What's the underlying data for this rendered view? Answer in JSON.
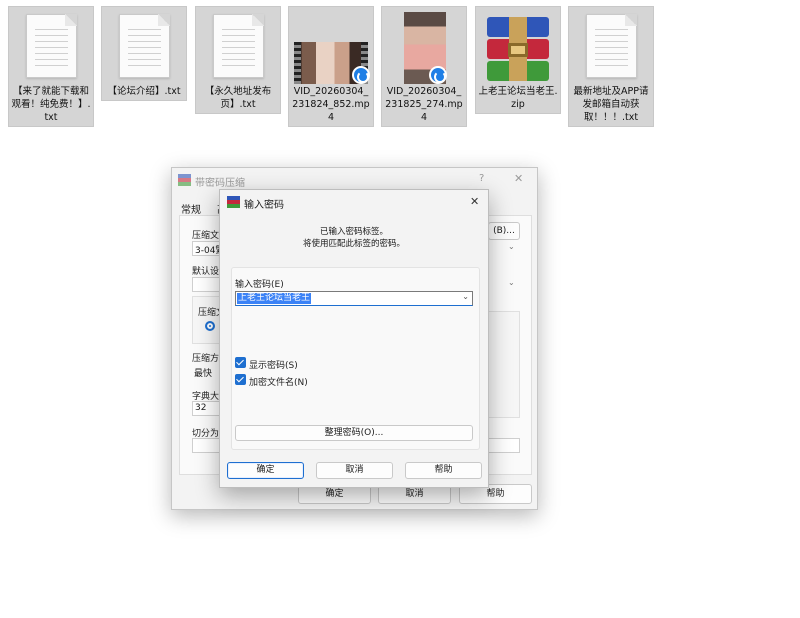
{
  "files": [
    {
      "name": "【来了就能下载和观看！纯免费！】.txt",
      "icon": "text-file-icon"
    },
    {
      "name": "【论坛介绍】.txt",
      "icon": "text-file-icon"
    },
    {
      "name": "【永久地址发布页】.txt",
      "icon": "text-file-icon"
    },
    {
      "name": "VID_20260304_231824_852.mp4",
      "icon": "video-file-icon"
    },
    {
      "name": "VID_20260304_231825_274.mp4",
      "icon": "video-file-icon"
    },
    {
      "name": "上老王论坛当老王.zip",
      "icon": "winrar-archive-icon"
    },
    {
      "name": "最新地址及APP请发邮箱自动获取！！！.txt",
      "icon": "text-file-icon"
    }
  ],
  "outer_dialog": {
    "title": "带密码压缩",
    "help": "?",
    "close": "✕",
    "tabs": [
      "常规",
      "高"
    ],
    "archive_label": "压缩文",
    "archive_value": "3-04繁",
    "browse_label": "(B)...",
    "default_label": "默认设",
    "format_label": "压缩文",
    "method_label": "压缩方",
    "method_value": "最快",
    "dict_label": "字典大",
    "dict_value": "32",
    "split_label": "切分为",
    "ok": "确定",
    "cancel": "取消",
    "help_btn": "帮助"
  },
  "inner_dialog": {
    "title": "输入密码",
    "close": "✕",
    "info_line1": "已输入密码标签。",
    "info_line2": "将使用匹配此标签的密码。",
    "password_label": "输入密码(E)",
    "password_value": "上老王论坛当老王",
    "show_password": "显示密码(S)",
    "encrypt_names": "加密文件名(N)",
    "organize": "整理密码(O)...",
    "ok": "确定",
    "cancel": "取消",
    "help": "帮助"
  },
  "colors": {
    "accent": "#1e6fd0",
    "selection": "#3b82f6",
    "tile_bg": "#d5d5d5"
  }
}
